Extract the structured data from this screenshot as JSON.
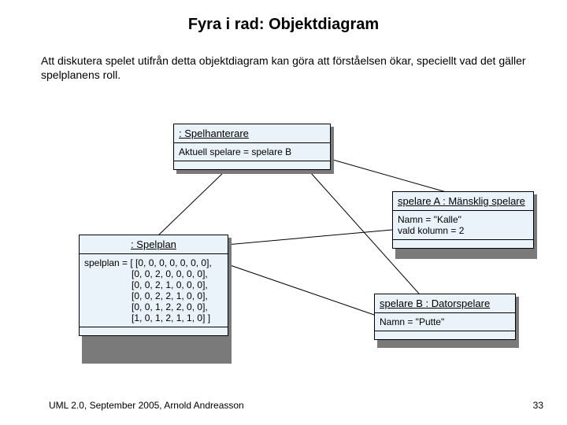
{
  "title": "Fyra i rad: Objektdiagram",
  "description": "Att diskutera spelet utifrån detta objektdiagram kan göra att förståelsen ökar, speciellt vad det gäller spelplanens roll.",
  "objects": {
    "spelhanterare": {
      "name": ": Spelhanterare",
      "attr": "Aktuell spelare = spelare B"
    },
    "spelplan": {
      "name": ": Spelplan",
      "attr": "spelplan = [ [0, 0, 0, 0, 0, 0, 0],\n                  [0, 0, 2, 0, 0, 0, 0],\n                  [0, 0, 2, 1, 0, 0, 0],\n                  [0, 0, 2, 2, 1, 0, 0],\n                  [0, 0, 1, 2, 2, 0, 0],\n                  [1, 0, 1, 2, 1, 1, 0] ]"
    },
    "spelareA": {
      "name": "spelare A : Mänsklig spelare",
      "attr": "Namn = \"Kalle\"\nvald kolumn = 2"
    },
    "spelareB": {
      "name": "spelare B : Datorspelare",
      "attr": "Namn = \"Putte\""
    }
  },
  "footer": {
    "left": "UML 2.0, September 2005, Arnold Andreasson",
    "page": "33"
  }
}
